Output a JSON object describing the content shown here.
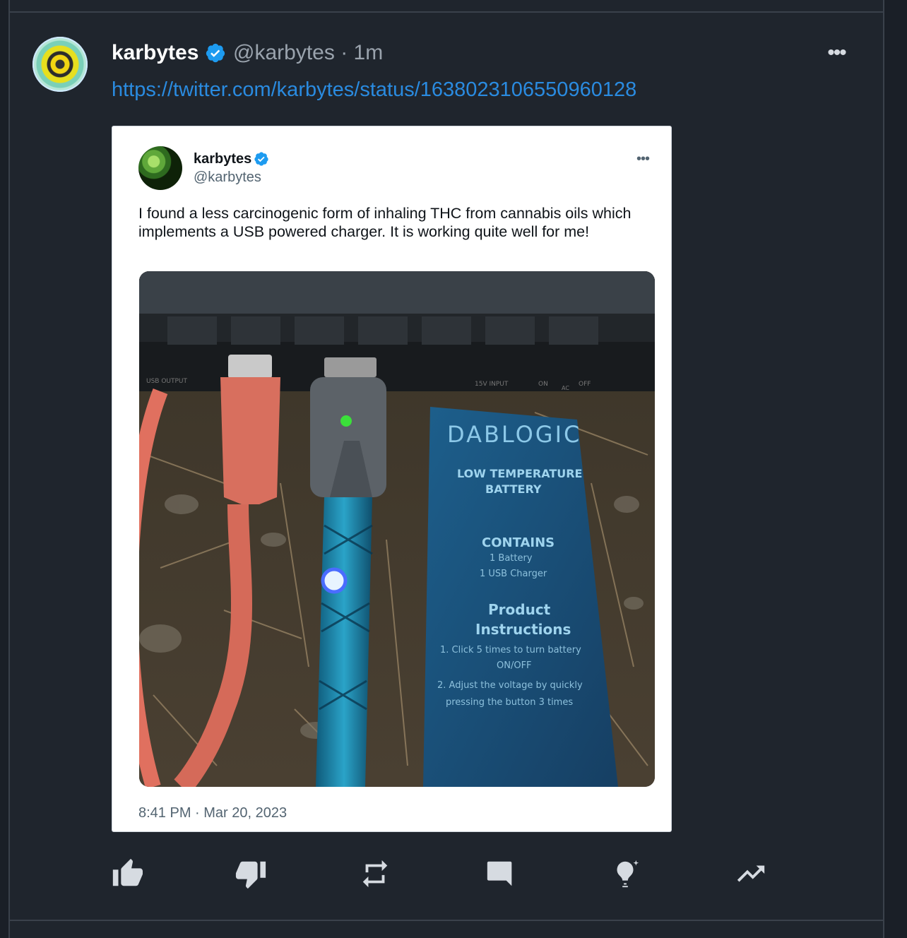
{
  "post": {
    "author_name": "karbytes",
    "author_handle": "@karbytes",
    "time_separator": "·",
    "relative_time": "1m",
    "more_icon": "more-horizontal-icon",
    "link_text": "https://twitter.com/karbytes/status/1638023106550960128"
  },
  "embedded_tweet": {
    "name": "karbytes",
    "handle": "@karbytes",
    "text": "I found a less carcinogenic form of inhaling THC from cannabis oils which implements a USB powered charger. It is working quite well for me!",
    "timestamp": "8:41 PM · Mar 20, 2023",
    "photo": {
      "box_brand": "DABLOGIC",
      "box_line1": "LOW TEMPERATURE",
      "box_line2": "BATTERY",
      "contains_title": "CONTAINS",
      "contains_1": "1 Battery",
      "contains_2": "1 USB Charger",
      "instructions_title_1": "Product",
      "instructions_title_2": "Instructions",
      "instr_1a": "1. Click 5 times to turn battery",
      "instr_1b": "ON/OFF",
      "instr_2a": "2. Adjust the voltage by quickly",
      "instr_2b": "pressing the button 3 times",
      "panel_label_1": "USB OUTPUT",
      "panel_label_2": "15V INPUT",
      "panel_label_3": "ON",
      "panel_label_4": "AC",
      "panel_label_5": "OFF"
    }
  },
  "actions": [
    {
      "name": "like-button",
      "icon": "thumbs-up-icon"
    },
    {
      "name": "dislike-button",
      "icon": "thumbs-down-icon"
    },
    {
      "name": "repost-button",
      "icon": "repost-icon"
    },
    {
      "name": "comment-button",
      "icon": "comment-icon"
    },
    {
      "name": "insight-button",
      "icon": "lightbulb-icon"
    },
    {
      "name": "trending-button",
      "icon": "trending-up-icon"
    }
  ],
  "colors": {
    "background": "#1f252d",
    "link": "#2a8be0",
    "verified": "#1d9bf0",
    "muted": "#9aa3ad"
  }
}
